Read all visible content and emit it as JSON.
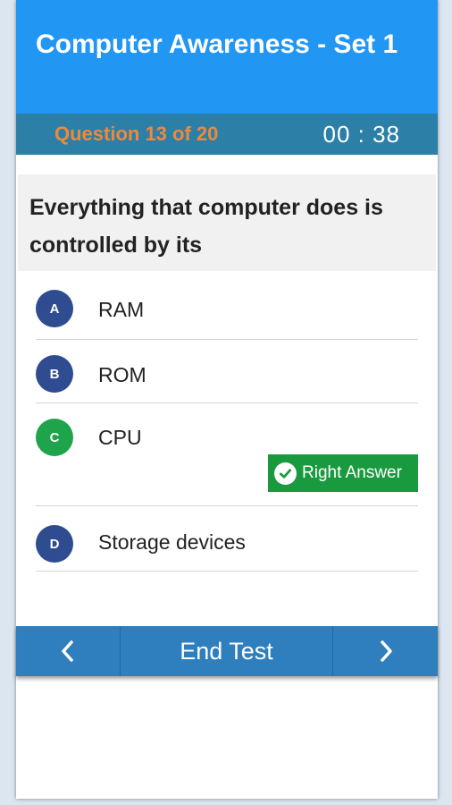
{
  "header": {
    "title": "Computer Awareness - Set 1"
  },
  "status": {
    "question_counter": "Question 13 of 20",
    "timer": "00 : 38"
  },
  "question": {
    "text": "Everything that computer does is controlled by its"
  },
  "options": [
    {
      "letter": "A",
      "label": "RAM",
      "color": "#2e4c8f",
      "correct": false
    },
    {
      "letter": "B",
      "label": "ROM",
      "color": "#2e4c8f",
      "correct": false
    },
    {
      "letter": "C",
      "label": "CPU",
      "color": "#1ea44a",
      "correct": true
    },
    {
      "letter": "D",
      "label": "Storage devices",
      "color": "#2e4c8f",
      "correct": false
    }
  ],
  "feedback": {
    "right_answer_label": "Right Answer",
    "icon": "check-circle-icon"
  },
  "nav": {
    "prev_icon": "chevron-left-icon",
    "end_label": "End Test",
    "next_icon": "chevron-right-icon"
  },
  "colors": {
    "header": "#2196f3",
    "status_bar": "#2c80a8",
    "counter_text": "#f0883a",
    "nav_bar": "#2f7ebd",
    "correct": "#1a9a3f"
  }
}
